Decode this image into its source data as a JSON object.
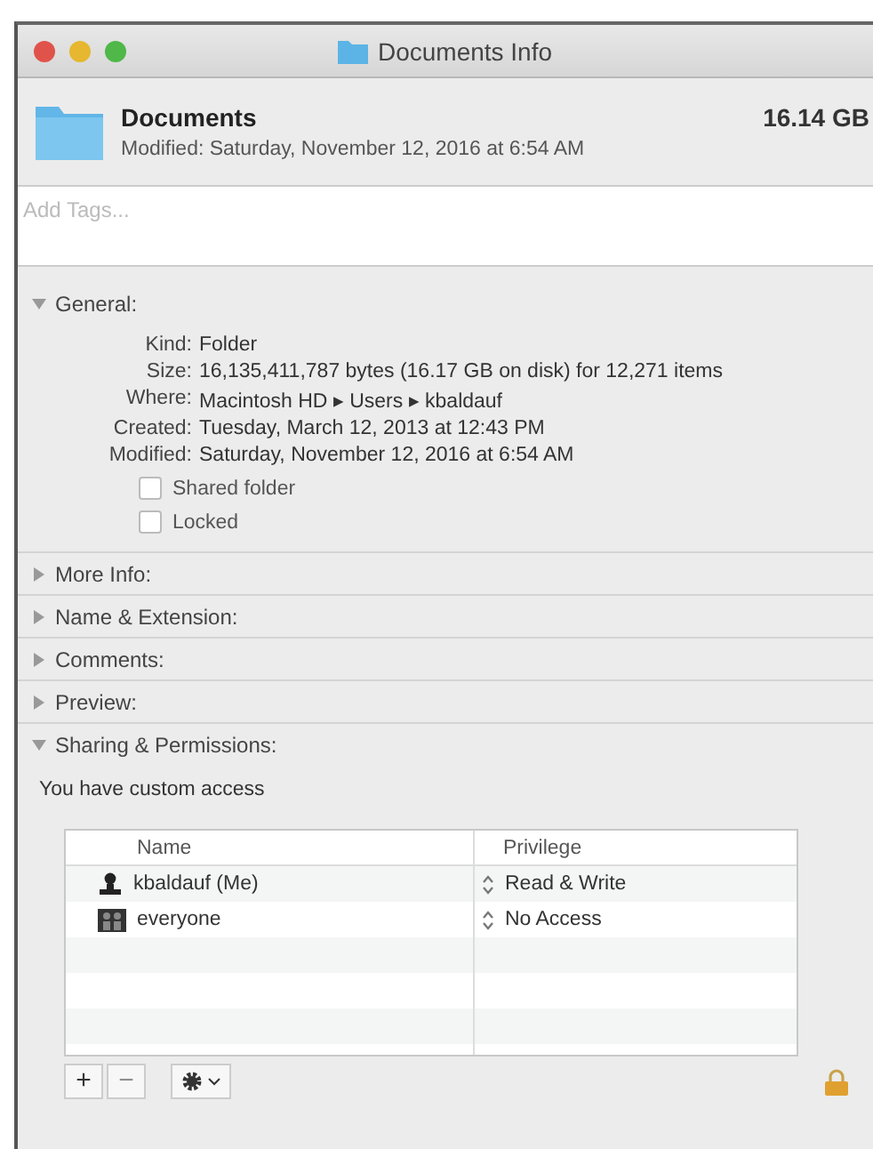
{
  "window": {
    "title": "Documents Info"
  },
  "header": {
    "name": "Documents",
    "size": "16.14 GB",
    "modified": "Modified: Saturday, November 12, 2016 at 6:54 AM"
  },
  "tags": {
    "placeholder": "Add Tags..."
  },
  "general": {
    "title": "General:",
    "expanded": true,
    "fields": [
      {
        "label": "Kind:",
        "value": "Folder"
      },
      {
        "label": "Size:",
        "value": "16,135,411,787 bytes (16.17 GB on disk) for 12,271 items"
      },
      {
        "label": "Where:",
        "value": "Macintosh HD ▸ Users ▸ kbaldauf"
      },
      {
        "label": "Created:",
        "value": "Tuesday, March 12, 2013 at 12:43 PM"
      },
      {
        "label": "Modified:",
        "value": "Saturday, November 12, 2016 at 6:54 AM"
      }
    ],
    "options": [
      {
        "label": "Shared folder",
        "checked": false
      },
      {
        "label": "Locked",
        "checked": false
      }
    ]
  },
  "sections": [
    {
      "title": "More Info:",
      "expanded": false
    },
    {
      "title": "Name & Extension:",
      "expanded": false
    },
    {
      "title": "Comments:",
      "expanded": false
    },
    {
      "title": "Preview:",
      "expanded": false
    }
  ],
  "sharing": {
    "title": "Sharing & Permissions:",
    "expanded": true,
    "note": "You have custom access",
    "columns": [
      "Name",
      "Privilege"
    ],
    "rows": [
      {
        "kind": "user",
        "name": "kbaldauf (Me)",
        "privilege": "Read & Write"
      },
      {
        "kind": "group",
        "name": "everyone",
        "privilege": "No Access"
      }
    ]
  },
  "toolbar": {
    "add": "+",
    "remove": "−",
    "remove_disabled": true
  }
}
